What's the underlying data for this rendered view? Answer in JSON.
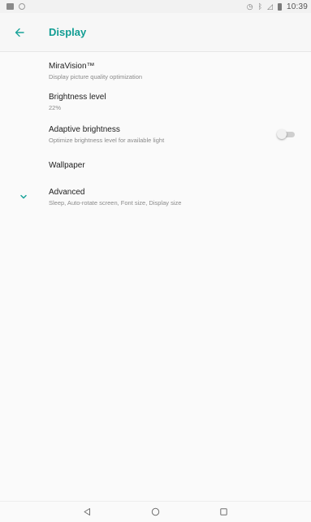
{
  "status_bar": {
    "time": "10:39",
    "icons": [
      "notification-icon",
      "sync-ring-icon",
      "alarm-icon",
      "bluetooth-icon",
      "signal-icon",
      "battery-icon"
    ]
  },
  "toolbar": {
    "title": "Display",
    "accent_color": "#119d93"
  },
  "settings": [
    {
      "title": "MiraVision™",
      "summary": "Display picture quality optimization"
    },
    {
      "title": "Brightness level",
      "summary": "22%"
    },
    {
      "title": "Adaptive brightness",
      "summary": "Optimize brightness level for available light",
      "toggle_on": false
    },
    {
      "title": "Wallpaper",
      "summary": ""
    },
    {
      "title": "Advanced",
      "summary": "Sleep, Auto-rotate screen, Font size, Display size"
    }
  ],
  "nav": [
    "back-icon",
    "home-icon",
    "recents-icon"
  ]
}
